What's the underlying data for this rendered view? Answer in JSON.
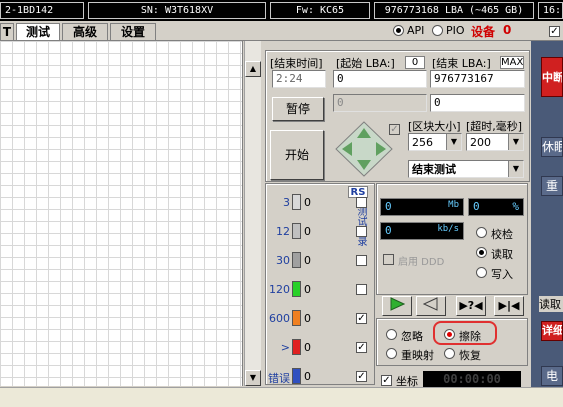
{
  "status_bar": {
    "model_fragment": "2-1BD142",
    "serial": "SN: W3T618XV",
    "firmware": "Fw: KC65",
    "capacity": "976773168 LBA (~465 GB)",
    "time_fragment": "16:"
  },
  "tabs": [
    {
      "label": "T"
    },
    {
      "label": "测试"
    },
    {
      "label": "高级"
    },
    {
      "label": "设置"
    }
  ],
  "mode": {
    "api_label": "API",
    "pio_label": "PIO",
    "device_label": "设备",
    "device_value": "0",
    "selected": "API"
  },
  "params": {
    "end_time_label": "[结束时间]",
    "end_time_value": "2:24",
    "start_lba_label": "[起始 LBA:]",
    "start_lba_tag": "0",
    "start_lba_value": "0",
    "end_lba_label": "[结束 LBA:]",
    "end_lba_tag": "MAX",
    "end_lba_value": "976773167",
    "disabled_field_value": "0",
    "second_lba_value": "0",
    "pause_label": "暂停",
    "start_label": "开始",
    "block_size_label": "[区块大小]",
    "block_size_value": "256",
    "timeout_label": "[超时,毫秒]",
    "timeout_value": "200",
    "end_action_value": "结束测试"
  },
  "legend": {
    "rs_label": "RS",
    "vertical_label": "测试记录",
    "rows": [
      {
        "threshold": "3",
        "count": "0",
        "color": "#d8d8d8",
        "checked": false
      },
      {
        "threshold": "12",
        "count": "0",
        "color": "#c0c0c0",
        "checked": false
      },
      {
        "threshold": "30",
        "count": "0",
        "color": "#a0a0a0",
        "checked": false
      },
      {
        "threshold": "120",
        "count": "0",
        "color": "#28d028",
        "checked": false
      },
      {
        "threshold": "600",
        "count": "0",
        "color": "#f08020",
        "checked": true
      },
      {
        "threshold": ">",
        "count": "0",
        "color": "#e02020",
        "checked": true
      },
      {
        "threshold": "错误",
        "count": "0",
        "color": "#3050c0",
        "checked": true
      }
    ]
  },
  "stats": {
    "speed_value": "0",
    "speed_unit": "Mb",
    "percent_value": "0",
    "percent_unit": "%",
    "rate_value": "0",
    "rate_unit": "kb/s",
    "ddd_label": "启用 DDD",
    "verify_label": "校检",
    "read_label": "读取",
    "write_label": "写入",
    "selected_mode": "读取"
  },
  "actions": {
    "ignore_label": "忽略",
    "erase_label": "擦除",
    "remap_label": "重映射",
    "restore_label": "恢复",
    "selected": "擦除"
  },
  "grid_label": "坐标",
  "timer_value": "00:00:00",
  "sidebar": {
    "stop_label": "中断",
    "sleep_label": "休眠",
    "recal_label": "重",
    "read_fragment": "读取",
    "detail_label": "详细",
    "power_label": "电"
  }
}
